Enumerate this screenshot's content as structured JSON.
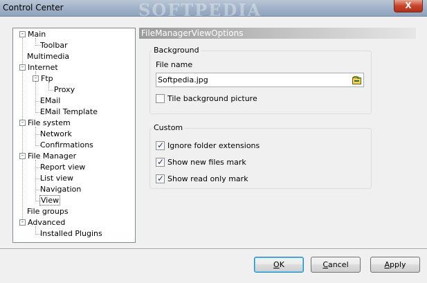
{
  "window": {
    "title": "Control Center",
    "watermark": "SOFTPEDIA",
    "close_glyph": "X"
  },
  "tree": {
    "items": [
      {
        "label": "Main",
        "expander": "-"
      },
      {
        "label": "Toolbar"
      },
      {
        "label": "Multimedia"
      },
      {
        "label": "Internet",
        "expander": "-"
      },
      {
        "label": "Ftp",
        "expander": "-"
      },
      {
        "label": "Proxy"
      },
      {
        "label": "EMail"
      },
      {
        "label": "EMail Template"
      },
      {
        "label": "File system",
        "expander": "-"
      },
      {
        "label": "Network"
      },
      {
        "label": "Confirmations"
      },
      {
        "label": "File Manager",
        "expander": "-"
      },
      {
        "label": "Report view"
      },
      {
        "label": "List view"
      },
      {
        "label": "Navigation"
      },
      {
        "label": "View",
        "selected": true
      },
      {
        "label": "File groups"
      },
      {
        "label": "Advanced",
        "expander": "-"
      },
      {
        "label": "Installed Plugins"
      }
    ]
  },
  "panel": {
    "header": "FileManagerViewOptions",
    "background_group": {
      "title": "Background",
      "file_name_label": "File name",
      "file_name_value": "Softpedia.jpg",
      "browse_icon": "folder-open-icon",
      "tile_label": "Tile background picture",
      "tile_checked": false
    },
    "custom_group": {
      "title": "Custom",
      "options": [
        {
          "label": "Ignore folder extensions",
          "checked": true
        },
        {
          "label": "Show new files mark",
          "checked": true
        },
        {
          "label": "Show read only mark",
          "checked": true
        }
      ]
    }
  },
  "buttons": {
    "ok": {
      "mnemonic": "O",
      "rest": "K"
    },
    "cancel": {
      "mnemonic": "C",
      "rest": "ancel"
    },
    "apply": {
      "mnemonic": "A",
      "rest": "pply"
    }
  },
  "check_glyph": "✓"
}
